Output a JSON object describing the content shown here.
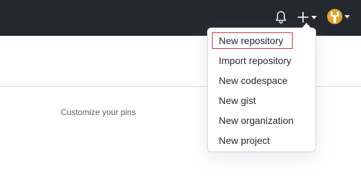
{
  "header": {
    "icons": {
      "notifications": "bell-icon",
      "create": "plus-icon",
      "create_menu_caret": "chevron-down-icon",
      "avatar_caret": "chevron-down-icon"
    }
  },
  "create_menu": {
    "items": [
      {
        "label": "New repository",
        "highlighted": true
      },
      {
        "label": "Import repository"
      },
      {
        "label": "New codespace"
      },
      {
        "label": "New gist"
      },
      {
        "label": "New organization"
      },
      {
        "label": "New project"
      }
    ]
  },
  "main": {
    "pins_link": "Customize your pins"
  },
  "colors": {
    "header_bg": "#24292f",
    "header_icon": "#f0f2f4",
    "avatar": "#e0a526",
    "highlight_outline": "#d0303a",
    "menu_text": "#24292f",
    "muted_text": "#57606a",
    "border": "#d0d7de"
  }
}
